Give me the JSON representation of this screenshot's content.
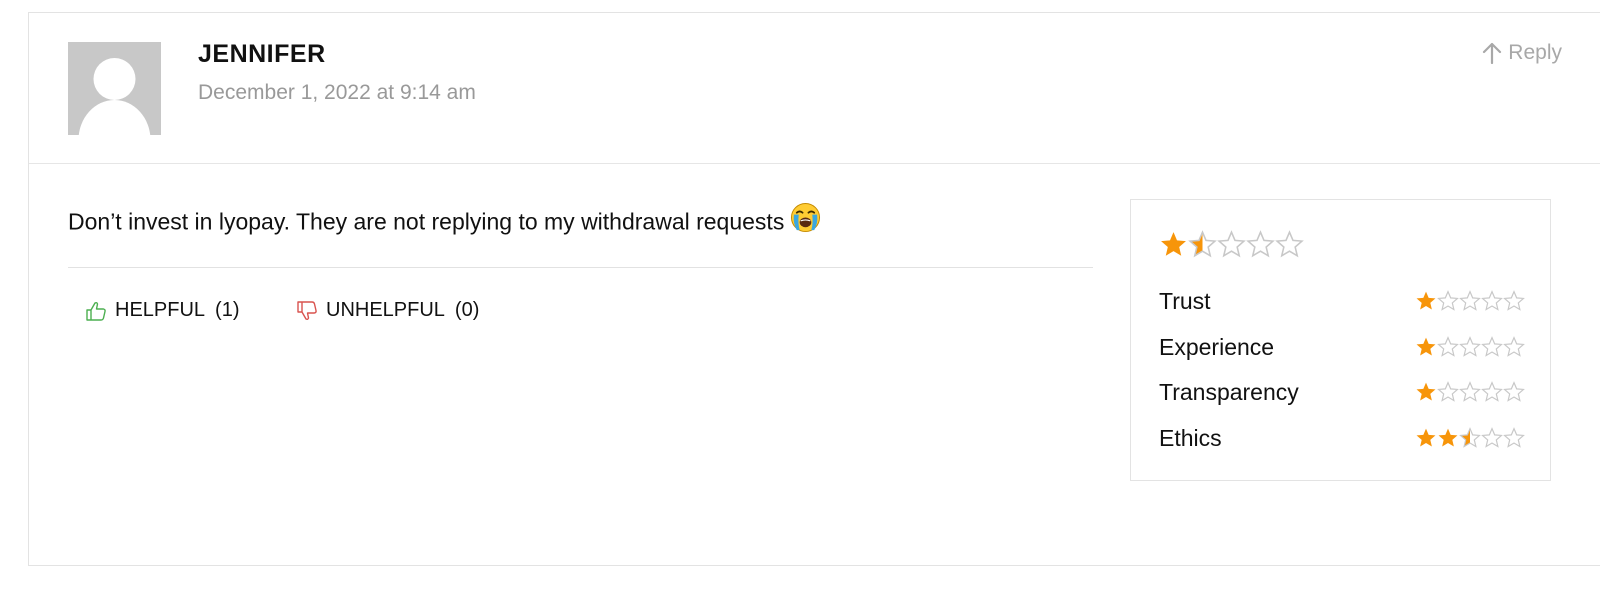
{
  "comment": {
    "author": "JENNIFER",
    "date": "December 1, 2022 at 9:14 am",
    "reply_label": "Reply",
    "text": "Don’t invest in lyopay. They are not replying to my withdrawal requests",
    "emoji": "loudly-crying-face",
    "helpful": {
      "label": "HELPFUL",
      "count": "(1)"
    },
    "unhelpful": {
      "label": "UNHELPFUL",
      "count": "(0)"
    }
  },
  "ratings": {
    "overall": 1.5,
    "max": 5,
    "criteria": [
      {
        "name": "Trust",
        "value": 1
      },
      {
        "name": "Experience",
        "value": 1
      },
      {
        "name": "Transparency",
        "value": 1
      },
      {
        "name": "Ethics",
        "value": 2.5
      }
    ]
  },
  "colors": {
    "star_filled": "#f7950a",
    "star_empty": "#c8c8c8",
    "helpful_icon": "#4caf50",
    "unhelpful_icon": "#d9534f",
    "muted_text": "#999999"
  },
  "icons": {
    "reply": "arrow-up-icon",
    "helpful": "thumbs-up-icon",
    "unhelpful": "thumbs-down-icon",
    "avatar": "user-placeholder-icon"
  }
}
